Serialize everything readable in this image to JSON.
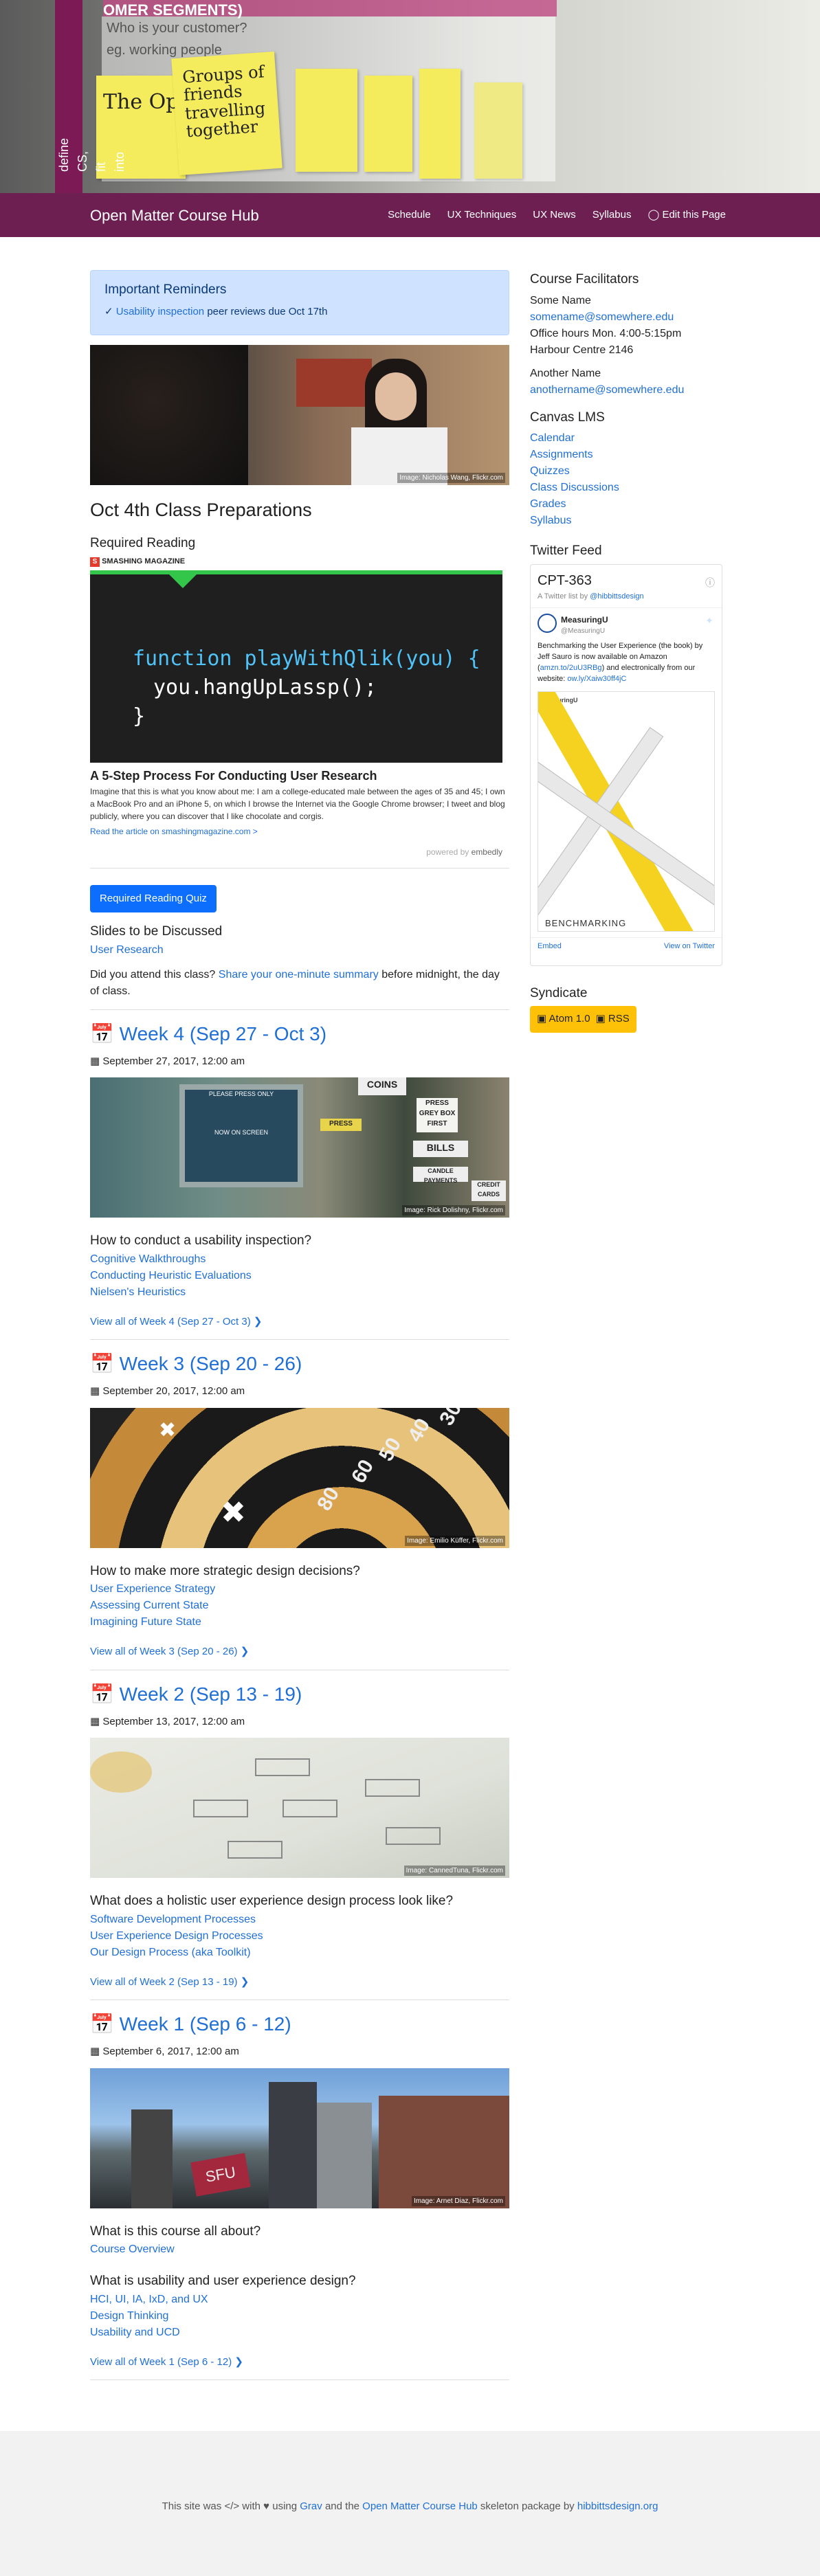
{
  "hero": {
    "wall_text": "OMER SEGMENTS)",
    "question": "Who is your customer?",
    "example": "eg. working people",
    "note1": "Groups of friends travelling together",
    "note2": "The Optimizer",
    "side_text": "define CS, fit into"
  },
  "nav": {
    "brand": "Open Matter Course Hub",
    "items": [
      "Schedule",
      "UX Techniques",
      "UX News",
      "Syllabus",
      "Edit this Page"
    ]
  },
  "reminders": {
    "title": "Important Reminders",
    "link": "Usability inspection",
    "rest": "peer reviews due Oct 17th"
  },
  "top_photo": {
    "credit": "Image: Nicholas Wang, Flickr.com"
  },
  "prep": {
    "title": "Oct 4th Class Preparations",
    "reading_heading": "Required Reading",
    "magazine": "SMASHING MAGAZINE",
    "code1": "function playWithQlik(you) {",
    "code2": "you.hangUpLassp();",
    "code3": "}",
    "article_title": "A 5-Step Process For Conducting User Research",
    "article_desc": "Imagine that this is what you know about me: I am a college-educated male between the ages of 35 and 45; I own a MacBook Pro and an iPhone 5, on which I browse the Internet via the Google Chrome browser; I tweet and blog publicly, where you can discover that I like chocolate and corgis.",
    "article_link": "Read the article on smashingmagazine.com >",
    "powered": "powered by",
    "embedly": "embedly",
    "quiz_button": "Required Reading Quiz",
    "slides_heading": "Slides to be Discussed",
    "slides_link": "User Research",
    "attend_pre": "Did you attend this class?",
    "attend_link": "Share your one-minute summary",
    "attend_post": "before midnight, the day of class."
  },
  "weeks": [
    {
      "title": "Week 4 (Sep 27 - Oct 3)",
      "date": "September 27, 2017, 12:00 am",
      "credit": "Image: Rick Dolishny, Flickr.com",
      "question": "How to conduct a usability inspection?",
      "links": [
        "Cognitive Walkthroughs",
        "Conducting Heuristic Evaluations",
        "Nielsen's Heuristics"
      ],
      "view_all": "View all of Week 4 (Sep 27 - Oct 3)"
    },
    {
      "title": "Week 3 (Sep 20 - 26)",
      "date": "September 20, 2017, 12:00 am",
      "credit": "Image: Emilio Küffer, Flickr.com",
      "question": "How to make more strategic design decisions?",
      "links": [
        "User Experience Strategy",
        "Assessing Current State",
        "Imagining Future State"
      ],
      "view_all": "View all of Week 3 (Sep 20 - 26)"
    },
    {
      "title": "Week 2 (Sep 13 - 19)",
      "date": "September 13, 2017, 12:00 am",
      "credit": "Image: CannedTuna, Flickr.com",
      "question": "What does a holistic user experience design process look like?",
      "links": [
        "Software Development Processes",
        "User Experience Design Processes",
        "Our Design Process (aka Toolkit)"
      ],
      "view_all": "View all of Week 2 (Sep 13 - 19)"
    },
    {
      "title": "Week 1 (Sep 6 - 12)",
      "date": "September 6, 2017, 12:00 am",
      "credit": "Image: Arnet Diaz, Flickr.com",
      "question": "What is this course all about?",
      "links": [
        "Course Overview"
      ],
      "question2": "What is usability and user experience design?",
      "links2": [
        "HCI, UI, IA, IxD, and UX",
        "Design Thinking",
        "Usability and UCD"
      ],
      "view_all": "View all of Week 1 (Sep 6 - 12)"
    }
  ],
  "week4_photo": {
    "screen_text1": "PLEASE PRESS ONLY",
    "screen_text2": "NOW ON SCREEN",
    "sign1": "COINS",
    "sign2": "PRESS GREY BOX FIRST",
    "sign3": "BILLS",
    "sign4": "CREDIT CARDS",
    "sign5": "CANDLE PAYMENTS",
    "sign6": "PRESS"
  },
  "week3_photo": {
    "nums": [
      "80",
      "60",
      "50",
      "40",
      "30"
    ]
  },
  "week1_photo": {
    "sign": "SFU"
  },
  "sidebar": {
    "facilitators_heading": "Course Facilitators",
    "name1": "Some Name",
    "email1": "somename@somewhere.edu",
    "hours": "Office hours Mon. 4:00-5:15pm",
    "office": "Harbour Centre 2146",
    "name2": "Another Name",
    "email2": "anothername@somewhere.edu",
    "lms_heading": "Canvas LMS",
    "lms_links": [
      "Calendar",
      "Assignments",
      "Quizzes",
      "Class Discussions",
      "Grades",
      "Syllabus"
    ],
    "twitter_heading": "Twitter Feed",
    "twitter": {
      "feed_title": "CPT-363",
      "feed_sub_pre": "A Twitter list by",
      "feed_sub_link": "@hibbittsdesign",
      "user": "MeasuringU",
      "handle": "@MeasuringU",
      "tweet_pre": "Benchmarking the User Experience (the book) by Jeff Sauro is now available on Amazon (",
      "tweet_link1": "amzn.to/2uU3RBg",
      "tweet_mid": ") and electronically from our website:",
      "tweet_link2": "ow.ly/Xaiw30ff4jC",
      "brand_in_img": "MeasuringU",
      "img_caption": "BENCHMARKING",
      "embed": "Embed",
      "view": "View on Twitter"
    },
    "syndicate_heading": "Syndicate",
    "atom": "Atom 1.0",
    "rss": "RSS"
  },
  "footer": {
    "pre": "This site was",
    "mid1": "with",
    "mid2": "using",
    "grav": "Grav",
    "and": "and the",
    "hub": "Open Matter Course Hub",
    "skel": "skeleton package by",
    "by": "hibbittsdesign.org"
  },
  "colors": {
    "nav": "#6d1f52",
    "link": "#1f6fd6",
    "alert_bg": "#cfe2ff",
    "button": "#0d6efd",
    "syndicate": "#ffc107"
  }
}
